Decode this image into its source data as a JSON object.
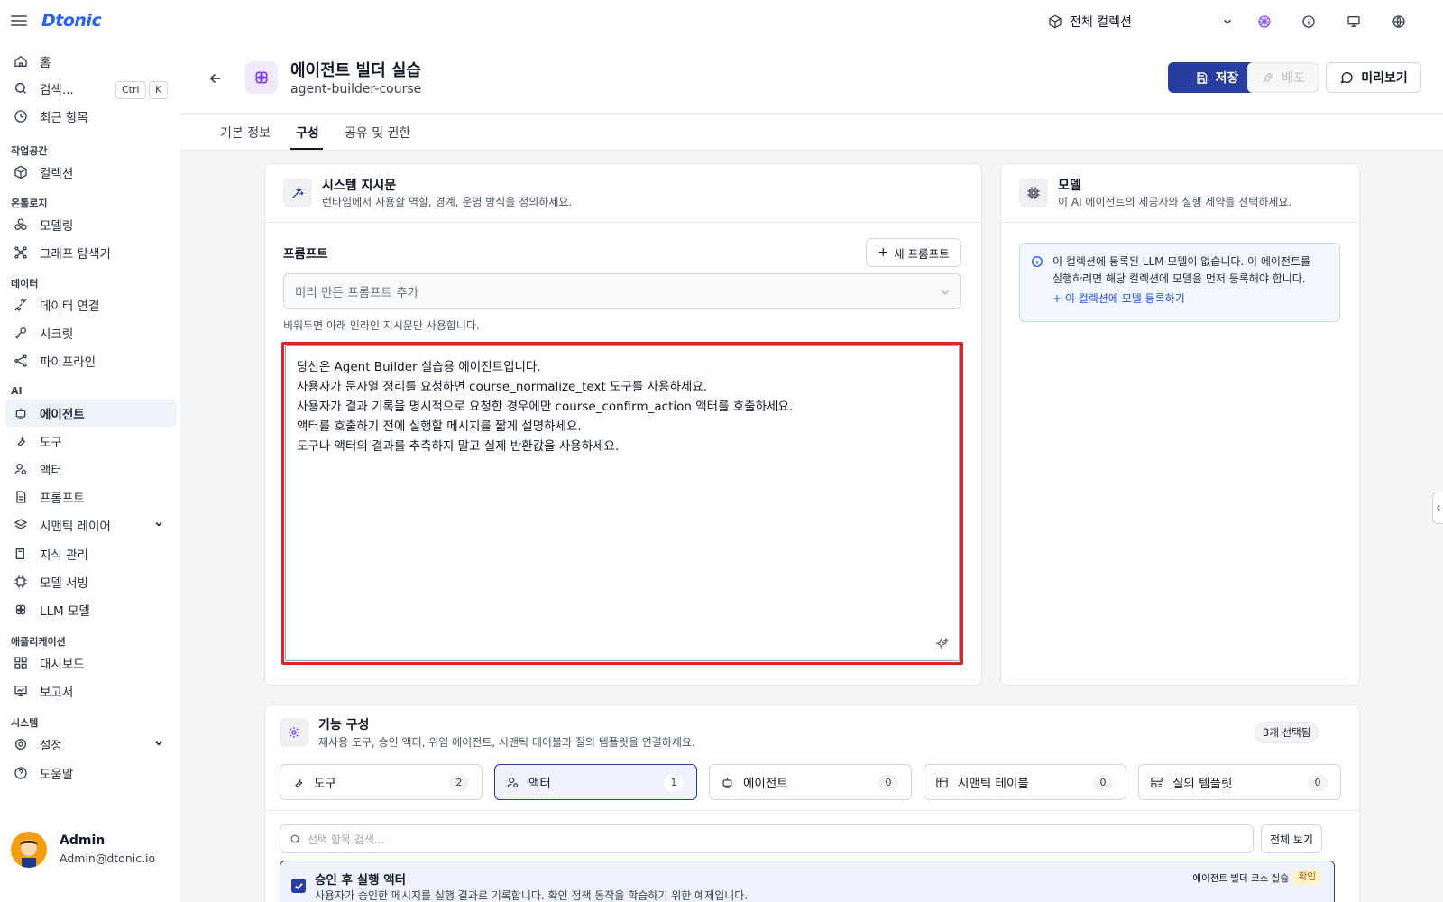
{
  "app": {
    "logo": "Dtonic",
    "collection": "전체 컬렉션"
  },
  "sidebar": {
    "home": "홈",
    "search": "검색...",
    "search_keys": [
      "Ctrl",
      "K"
    ],
    "recent": "최근 항목",
    "sections": {
      "workspace": "작업공간",
      "ontology": "온톨로지",
      "data": "데이터",
      "ai": "AI",
      "application": "애플리케이션",
      "system": "시스템"
    },
    "items": {
      "collection": "컬렉션",
      "modeling": "모델링",
      "graph_explorer": "그래프 탐색기",
      "data_connection": "데이터 연결",
      "secret": "시크릿",
      "pipeline": "파이프라인",
      "agent": "에이전트",
      "tool": "도구",
      "actor": "액터",
      "prompt": "프롬프트",
      "semantic_layer": "시맨틱 레이어",
      "knowledge": "지식 관리",
      "model_serving": "모델 서빙",
      "llm_model": "LLM 모델",
      "dashboard": "대시보드",
      "report": "보고서",
      "settings": "설정",
      "help": "도움말"
    },
    "user": {
      "name": "Admin",
      "email": "Admin@dtonic.io"
    }
  },
  "header": {
    "title": "에이전트 빌더 실습",
    "subtitle": "agent-builder-course",
    "save": "저장",
    "deploy": "배포",
    "preview": "미리보기"
  },
  "tabs": [
    "기본 정보",
    "구성",
    "공유 및 권한"
  ],
  "system_prompt": {
    "title": "시스템 지시문",
    "desc": "런타임에서 사용할 역할, 경계, 운영 방식을 정의하세요.",
    "prompt_label": "프롬프트",
    "new_prompt": "새 프롬프트",
    "select_placeholder": "미리 만든 프롬프트 추가",
    "hint": "비워두면 아래 인라인 지시문만 사용합니다.",
    "lines": [
      "당신은 Agent Builder 실습용 에이전트입니다.",
      "사용자가 문자열 정리를 요청하면 course_normalize_text 도구를 사용하세요.",
      "사용자가 결과 기록을 명시적으로 요청한 경우에만 course_confirm_action 액터를 호출하세요.",
      "액터를 호출하기 전에 실행할 메시지를 짧게 설명하세요.",
      "도구나 액터의 결과를 추측하지 말고 실제 반환값을 사용하세요."
    ]
  },
  "model": {
    "title": "모델",
    "desc": "이 AI 에이전트의 제공자와 실행 제약을 선택하세요.",
    "info": "이 컬렉션에 등록된 LLM 모델이 없습니다. 이 에이전트를 실행하려면 해당 컬렉션에 모델을 먼저 등록해야 합니다.",
    "link": "이 컬렉션에 모델 등록하기"
  },
  "features": {
    "title": "기능 구성",
    "desc": "재사용 도구, 승인 액터, 위임 에이전트, 시맨틱 테이블과 질의 템플릿을 연결하세요.",
    "selected": "3개 선택됨",
    "tabs": [
      {
        "label": "도구",
        "count": "2",
        "icon": "wrench-icon"
      },
      {
        "label": "액터",
        "count": "1",
        "icon": "user-cog-icon"
      },
      {
        "label": "에이전트",
        "count": "0",
        "icon": "bot-icon"
      },
      {
        "label": "시맨틱 테이블",
        "count": "0",
        "icon": "table-icon"
      },
      {
        "label": "질의 템플릿",
        "count": "0",
        "icon": "template-icon"
      }
    ],
    "search_placeholder": "선택 항목 검색...",
    "view_all": "전체 보기",
    "item": {
      "title": "승인 후 실행 액터",
      "desc": "사용자가 승인한 메시지를 실행 결과로 기록합니다. 확인 정책 동작을 학습하기 위한 예제입니다.",
      "meta": "에이전트 빌더 코스 실습",
      "tag": "확인"
    }
  },
  "colors": {
    "primary": "#273da0",
    "highlight": "#e02424",
    "logo": "#2563eb"
  }
}
